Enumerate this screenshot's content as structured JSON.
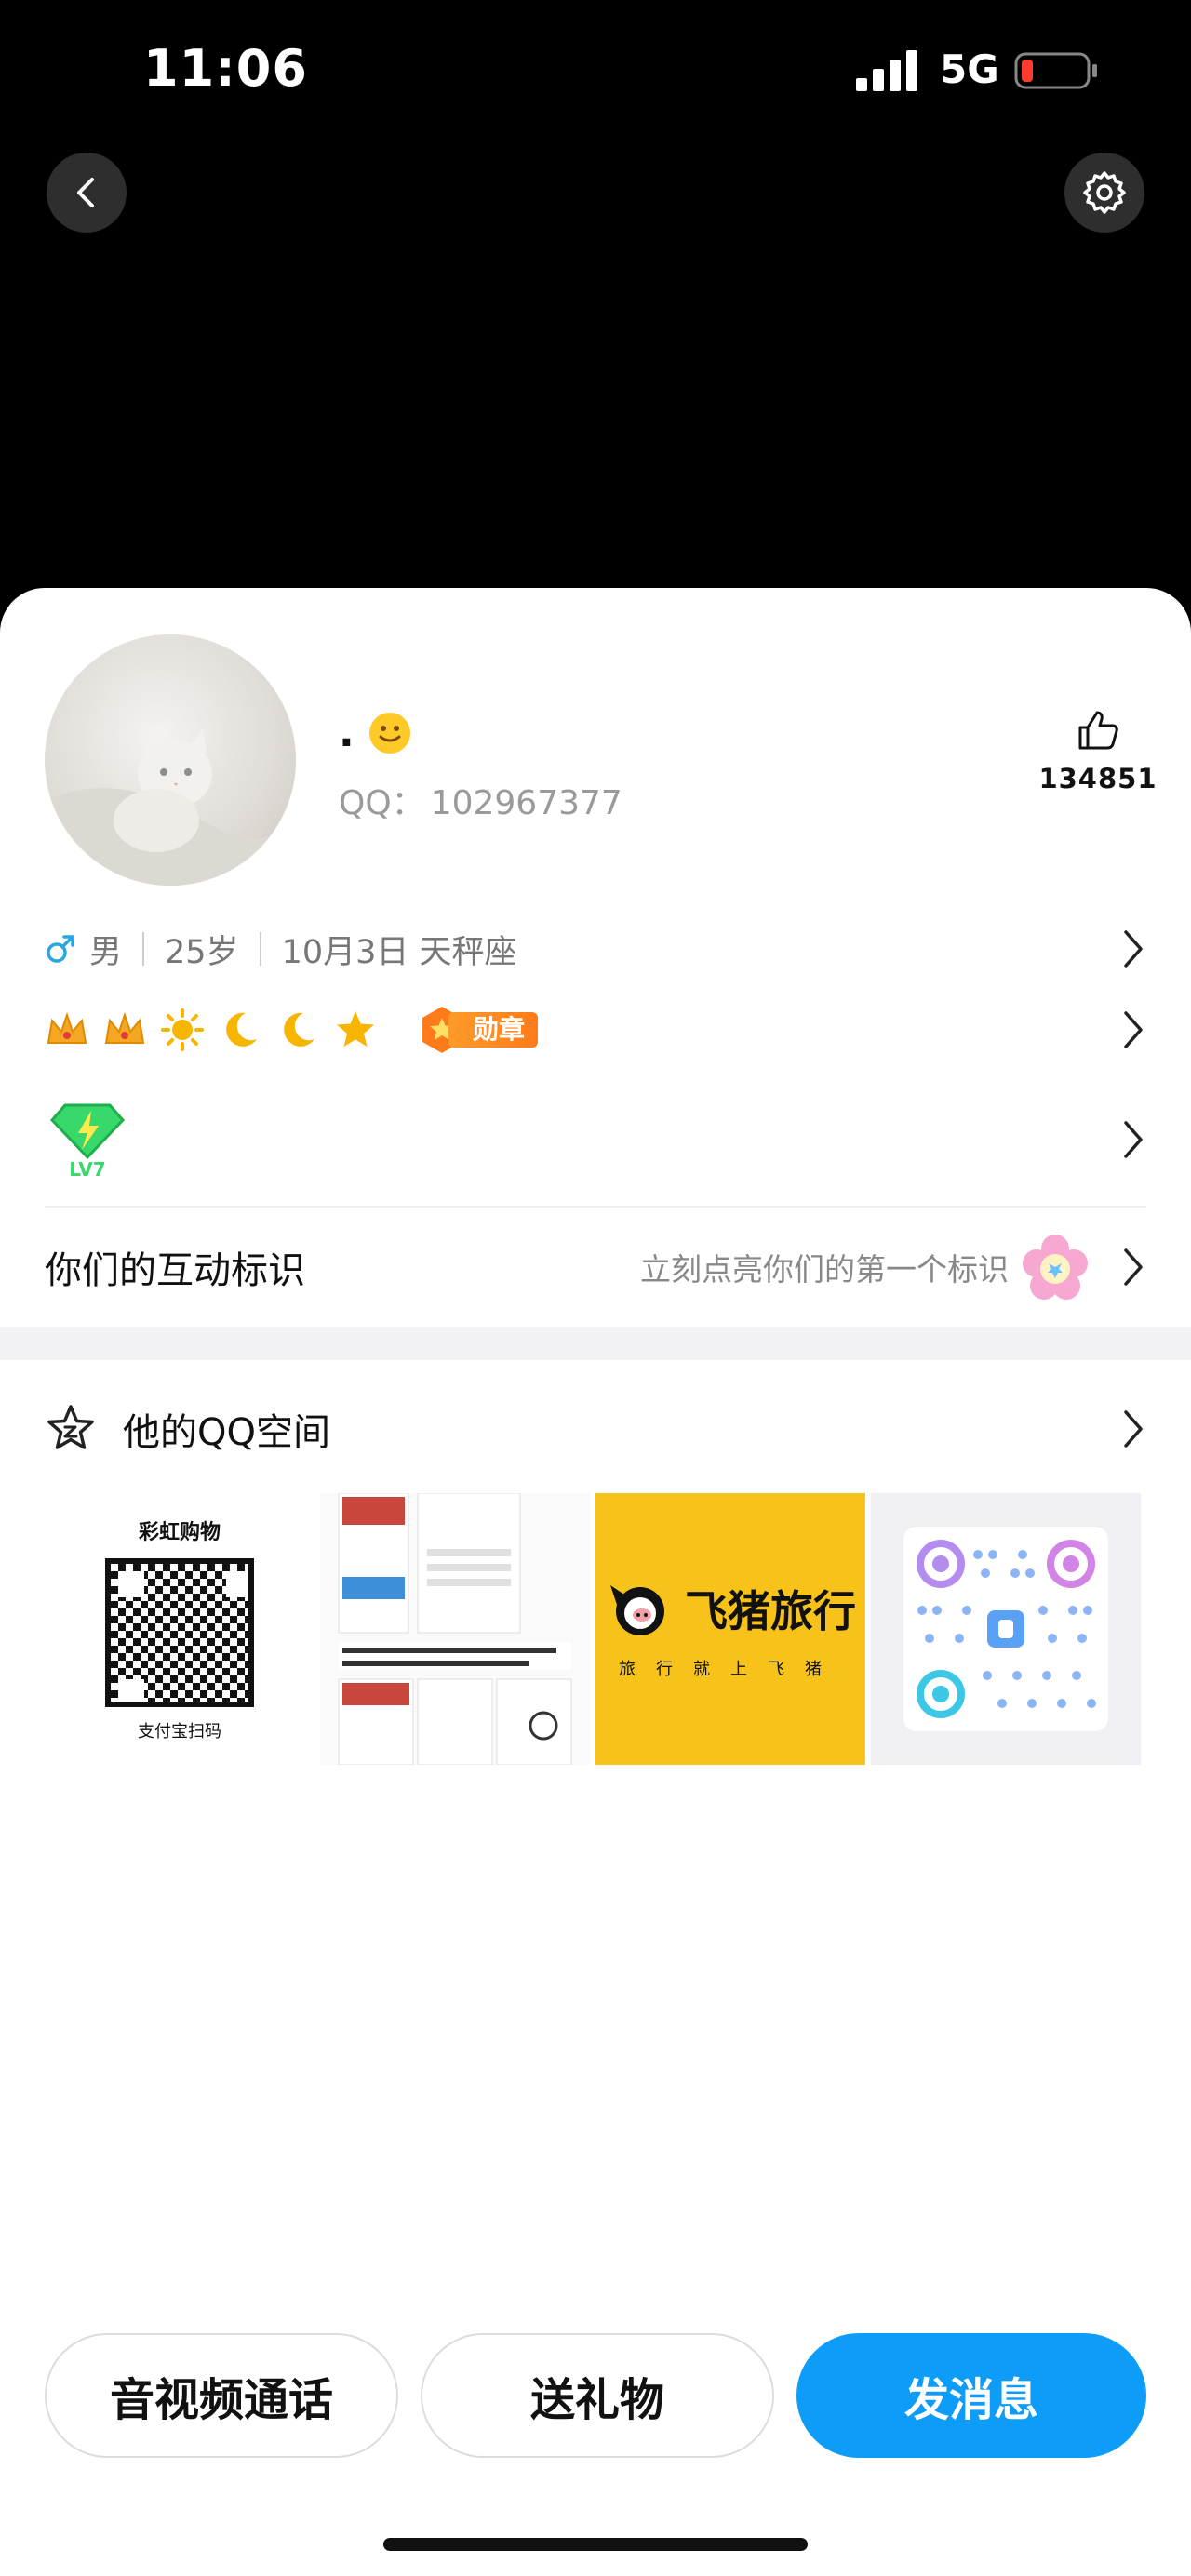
{
  "status": {
    "time": "11:06",
    "network": "5G",
    "battery_color": "#ff3b30"
  },
  "header": {
    "back_icon": "chevron-left-icon",
    "settings_icon": "gear-icon"
  },
  "profile": {
    "nickname": ".",
    "qq_label": "QQ：",
    "qq_number": "102967377",
    "likes": "134851"
  },
  "info": {
    "gender": "男",
    "age": "25岁",
    "birthday": "10月3日 天秤座"
  },
  "badges": {
    "medal_label": "勋章"
  },
  "interact": {
    "title": "你们的互动标识",
    "hint": "立刻点亮你们的第一个标识"
  },
  "qzone": {
    "title": "他的QQ空间",
    "thumb1_top": "彩虹购物",
    "thumb1_bottom": "支付宝扫码",
    "thumb3_title": "飞猪旅行",
    "thumb3_sub": "旅行就上飞猪"
  },
  "actions": {
    "call": "音视频通话",
    "gift": "送礼物",
    "message": "发消息"
  },
  "colors": {
    "primary": "#0d9cf7",
    "gender_male": "#2aa6e0",
    "crown": "#f5a623"
  }
}
